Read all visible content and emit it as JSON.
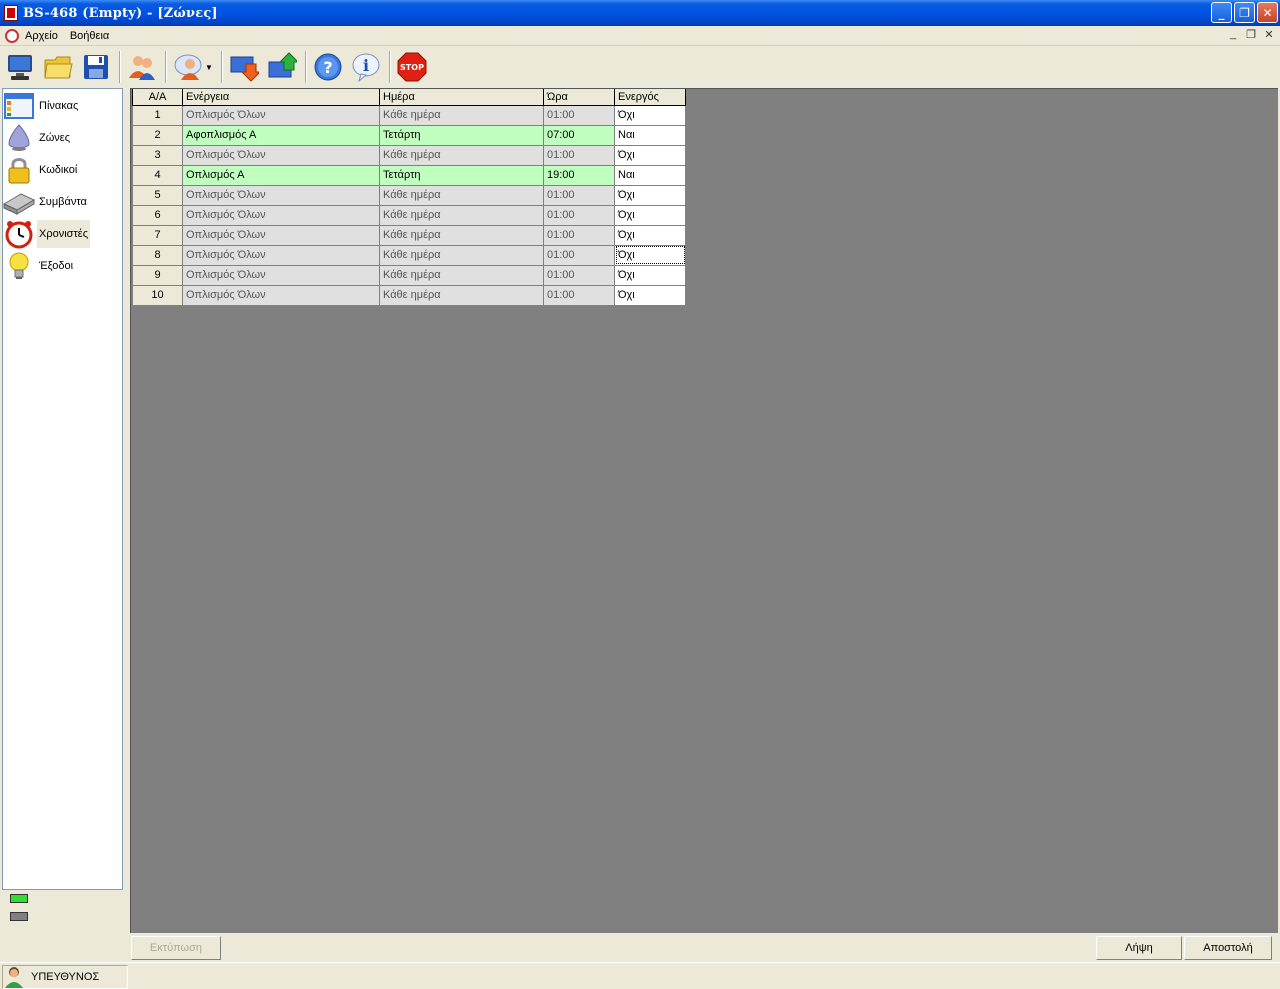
{
  "window": {
    "title": "BS-468 (Empty) - [Ζώνες]"
  },
  "menu": {
    "items": [
      "Αρχείο",
      "Βοήθεια"
    ]
  },
  "toolbar": {
    "buttons": [
      "monitor-icon",
      "folder-open-icon",
      "save-icon",
      "users-icon",
      "user-talk-icon",
      "download-icon",
      "upload-icon",
      "help-icon",
      "info-icon",
      "stop-icon"
    ],
    "stop_label": "STOP"
  },
  "nav": {
    "items": [
      {
        "label": "Πίνακας",
        "icon": "panel-icon"
      },
      {
        "label": "Ζώνες",
        "icon": "zone-icon"
      },
      {
        "label": "Κωδικοί",
        "icon": "lock-icon"
      },
      {
        "label": "Συμβάντα",
        "icon": "events-icon"
      },
      {
        "label": "Χρονιστές",
        "icon": "clock-icon",
        "active": true
      },
      {
        "label": "Έξοδοι",
        "icon": "bulb-icon"
      }
    ]
  },
  "legend": {
    "colors": [
      "#33dd33",
      "#808080"
    ]
  },
  "grid": {
    "headers": [
      "Α/Α",
      "Ενέργεια",
      "Ημέρα",
      "Ώρα",
      "Ενεργός"
    ],
    "rows": [
      {
        "num": "1",
        "action": "Οπλισμός Όλων",
        "day": "Κάθε ημέρα",
        "time": "01:00",
        "active": "Όχι"
      },
      {
        "num": "2",
        "action": "Αφοπλισμός Α",
        "day": "Τετάρτη",
        "time": "07:00",
        "active": "Ναι"
      },
      {
        "num": "3",
        "action": "Οπλισμός Όλων",
        "day": "Κάθε ημέρα",
        "time": "01:00",
        "active": "Όχι"
      },
      {
        "num": "4",
        "action": "Οπλισμός Α",
        "day": "Τετάρτη",
        "time": "19:00",
        "active": "Ναι"
      },
      {
        "num": "5",
        "action": "Οπλισμός Όλων",
        "day": "Κάθε ημέρα",
        "time": "01:00",
        "active": "Όχι"
      },
      {
        "num": "6",
        "action": "Οπλισμός Όλων",
        "day": "Κάθε ημέρα",
        "time": "01:00",
        "active": "Όχι"
      },
      {
        "num": "7",
        "action": "Οπλισμός Όλων",
        "day": "Κάθε ημέρα",
        "time": "01:00",
        "active": "Όχι"
      },
      {
        "num": "8",
        "action": "Οπλισμός Όλων",
        "day": "Κάθε ημέρα",
        "time": "01:00",
        "active": "Όχι"
      },
      {
        "num": "9",
        "action": "Οπλισμός Όλων",
        "day": "Κάθε ημέρα",
        "time": "01:00",
        "active": "Όχι"
      },
      {
        "num": "10",
        "action": "Οπλισμός Όλων",
        "day": "Κάθε ημέρα",
        "time": "01:00",
        "active": "Όχι"
      }
    ]
  },
  "bottom": {
    "print_label": "Εκτύπωση",
    "receive_label": "Λήψη",
    "send_label": "Αποστολή"
  },
  "status": {
    "user_label": "ΥΠΕΥΘΥΝΟΣ"
  },
  "colors": {
    "active_row": "#c0ffc0",
    "inactive_row": "#e0e0e0",
    "titlebar": "#0054e3"
  }
}
